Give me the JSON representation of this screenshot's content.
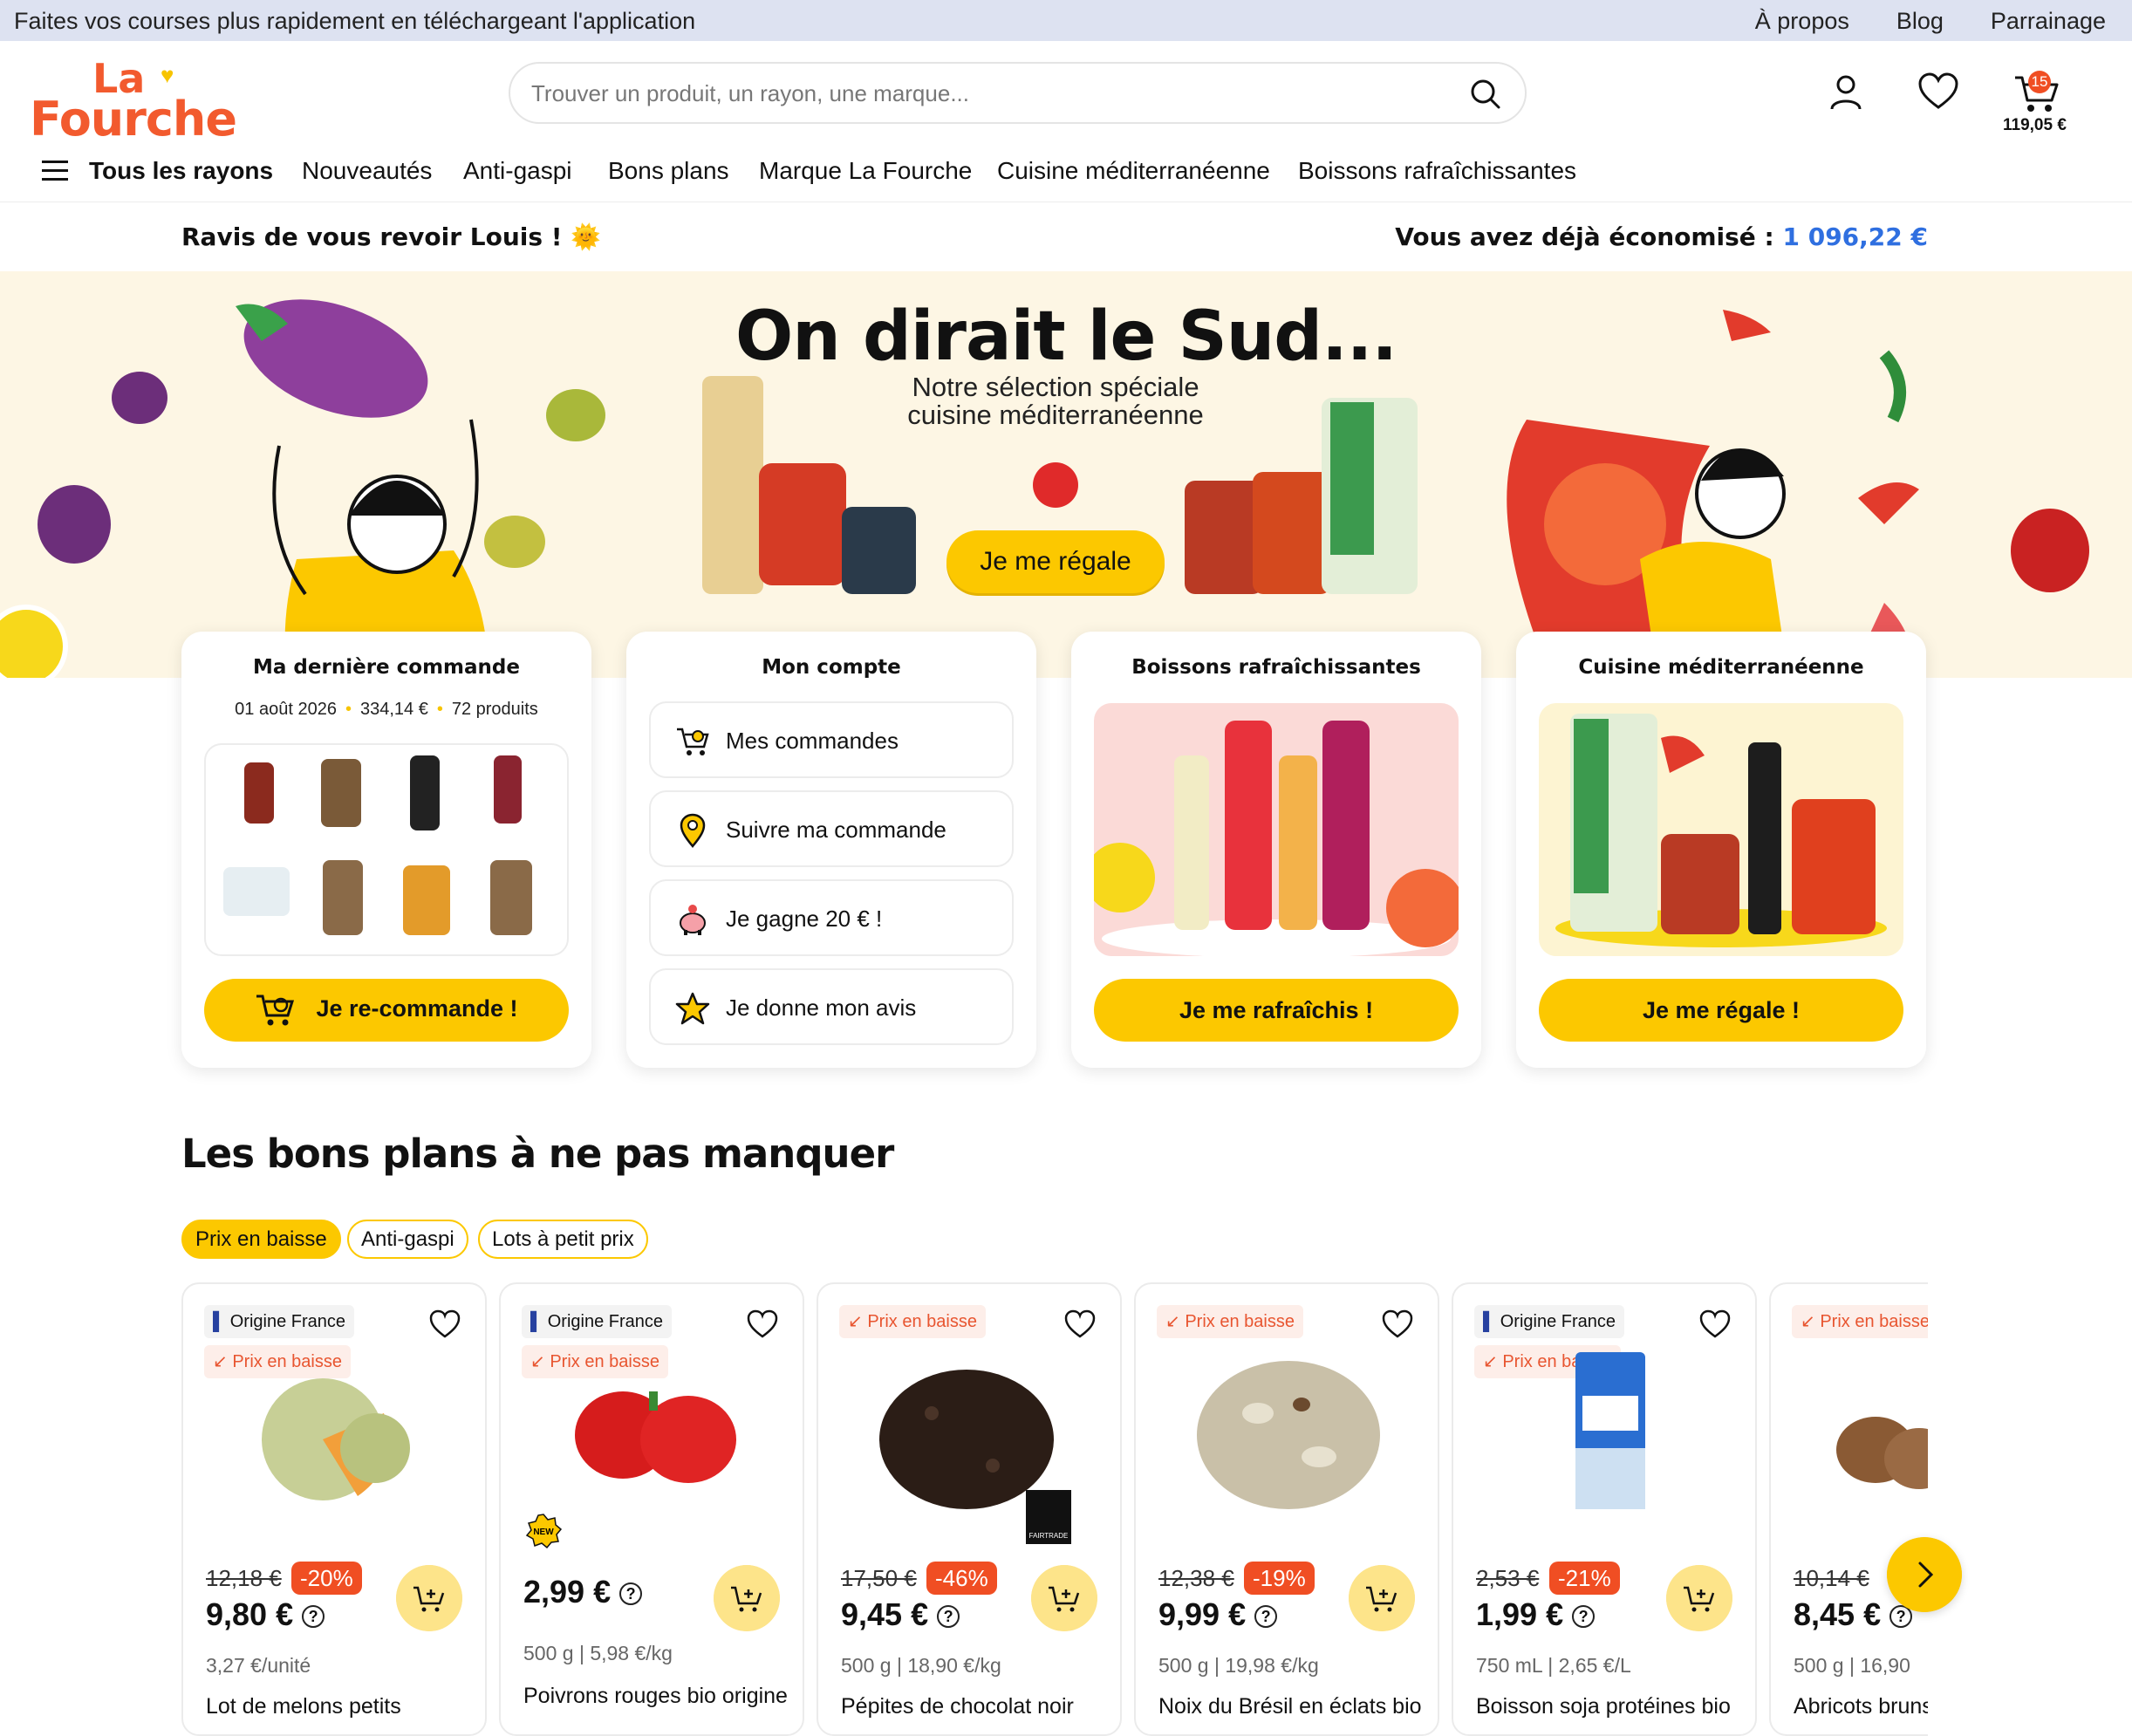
{
  "topbar": {
    "promo": "Faites vos courses plus rapidement en téléchargeant l'application",
    "links": [
      "À propos",
      "Blog",
      "Parrainage"
    ]
  },
  "logo": {
    "line1": "La",
    "line2": "Fourche"
  },
  "search": {
    "placeholder": "Trouver un produit, un rayon, une marque..."
  },
  "cart": {
    "count": "15",
    "total": "119,05 €"
  },
  "nav": {
    "all": "Tous les rayons",
    "items": [
      "Nouveautés",
      "Anti-gaspi",
      "Bons plans",
      "Marque La Fourche",
      "Cuisine méditerranéenne",
      "Boissons rafraîchissantes"
    ]
  },
  "welcome": {
    "text": "Ravis de vous revoir Louis !",
    "emoji": "🌞",
    "saved_label": "Vous avez déjà économisé :",
    "saved_value": "1 096,22 €"
  },
  "hero": {
    "title": "On dirait le Sud...",
    "subtitle_l1": "Notre sélection spéciale",
    "subtitle_l2": "cuisine méditerranéenne",
    "button": "Je me régale"
  },
  "cards": {
    "last_order": {
      "title": "Ma dernière commande",
      "date": "01 août 2026",
      "amount": "334,14 €",
      "products": "72 produits",
      "button": "Je re-commande !"
    },
    "account": {
      "title": "Mon compte",
      "items": [
        "Mes commandes",
        "Suivre ma commande",
        "Je gagne 20 € !",
        "Je donne mon avis"
      ]
    },
    "drinks": {
      "title": "Boissons rafraîchissantes",
      "button": "Je me rafraîchis !"
    },
    "med": {
      "title": "Cuisine méditerranéenne",
      "button": "Je me régale !"
    }
  },
  "deals": {
    "title": "Les bons plans à ne pas manquer",
    "chips": [
      "Prix en baisse",
      "Anti-gaspi",
      "Lots à petit prix"
    ],
    "products": [
      {
        "tag1": "Origine France",
        "tag2": "Prix en baisse",
        "old": "12,18 €",
        "disc": "-20%",
        "price": "9,80 €",
        "unit": "3,27 €/unité",
        "weight": "",
        "name": "Lot de melons petits"
      },
      {
        "tag1": "Origine France",
        "tag2": "Prix en baisse",
        "old": "",
        "disc": "",
        "price": "2,99 €",
        "unit": "5,98 €/kg",
        "weight": "500 g",
        "name": "Poivrons rouges bio origine",
        "badge": "NEW"
      },
      {
        "tag1": "Prix en baisse",
        "tag2": "",
        "old": "17,50 €",
        "disc": "-46%",
        "price": "9,45 €",
        "unit": "18,90 €/kg",
        "weight": "500 g",
        "name": "Pépites de chocolat noir",
        "badge": "FAIRTRADE"
      },
      {
        "tag1": "Prix en baisse",
        "tag2": "",
        "old": "12,38 €",
        "disc": "-19%",
        "price": "9,99 €",
        "unit": "19,98 €/kg",
        "weight": "500 g",
        "name": "Noix du Brésil en éclats bio"
      },
      {
        "tag1": "Origine France",
        "tag2": "Prix en baisse",
        "old": "2,53 €",
        "disc": "-21%",
        "price": "1,99 €",
        "unit": "2,65 €/L",
        "weight": "750 mL",
        "name": "Boisson soja protéines bio"
      },
      {
        "tag1": "Prix en baisse",
        "tag2": "",
        "old": "10,14 €",
        "disc": "",
        "price": "8,45 €",
        "unit": "16,90",
        "weight": "500 g",
        "name": "Abricots bruns"
      }
    ]
  },
  "colors": {
    "accent": "#fcc800",
    "brand": "#f25a2e",
    "discount": "#f04e23",
    "saved": "#2f6fe0"
  }
}
